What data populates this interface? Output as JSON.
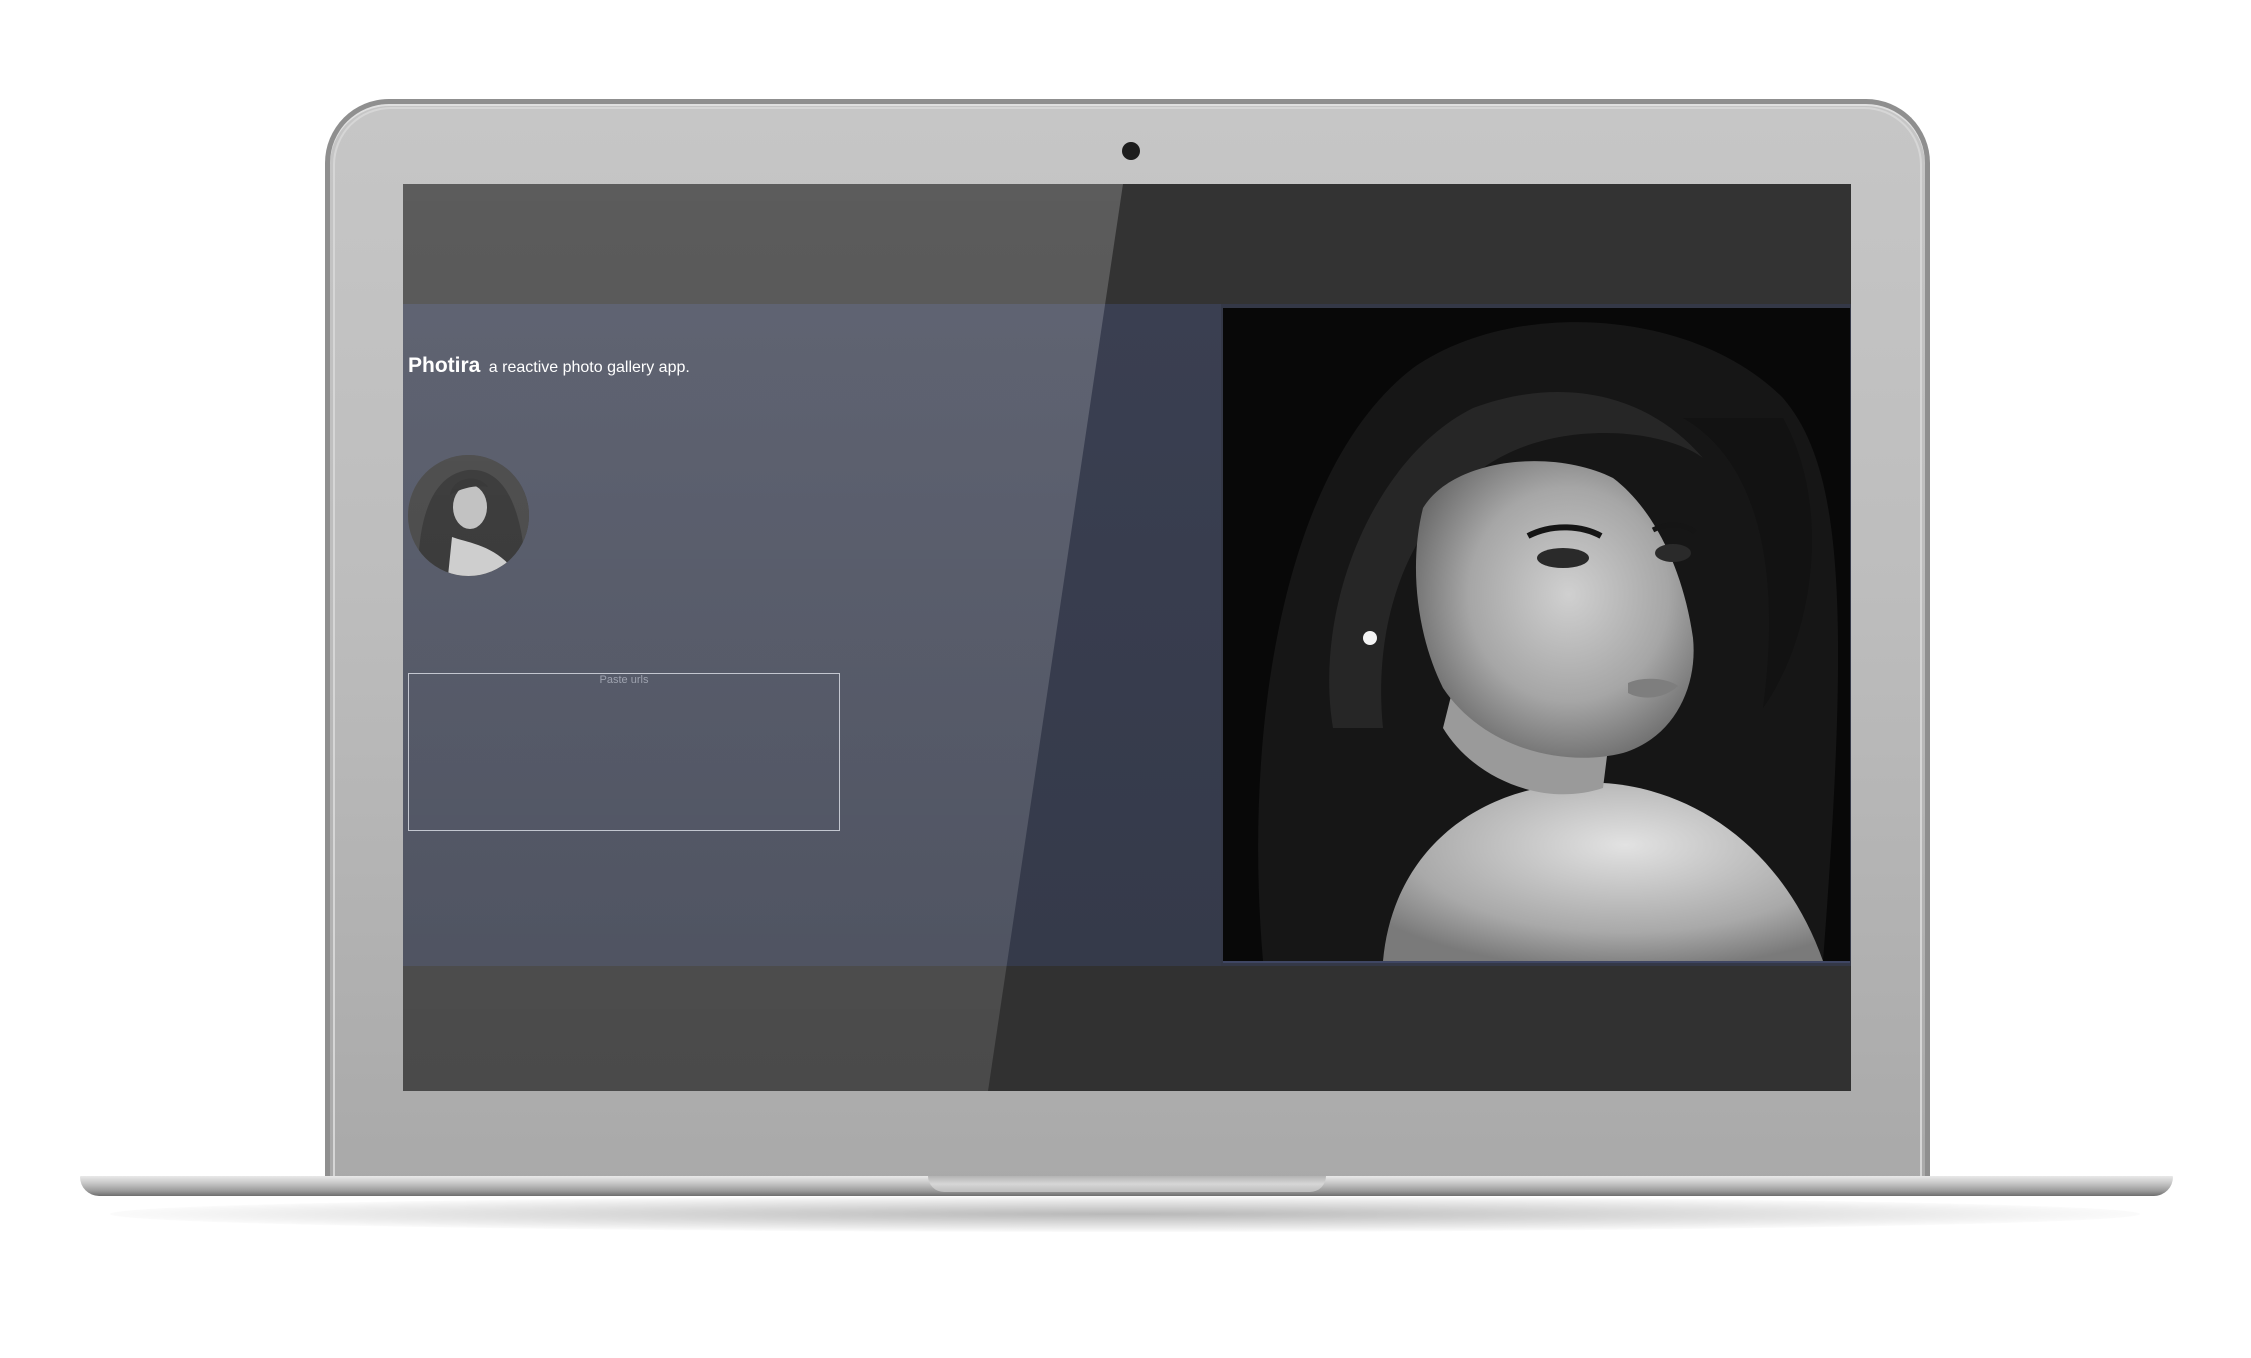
{
  "app": {
    "brand": "Photira",
    "tagline": "a reactive photo gallery app."
  },
  "gallery": {
    "thumbnails": [
      {
        "alt": "portrait-thumbnail",
        "selected": true
      }
    ]
  },
  "url_input": {
    "placeholder": "Paste urls",
    "value": ""
  },
  "viewer": {
    "image_name": "portrait-photo"
  },
  "colors": {
    "panel_background": "#3a3f51",
    "screen_band": "#333333",
    "text": "#ffffff",
    "input_border": "#b8bcc7"
  },
  "icons": {
    "webcam": "webcam-icon"
  }
}
